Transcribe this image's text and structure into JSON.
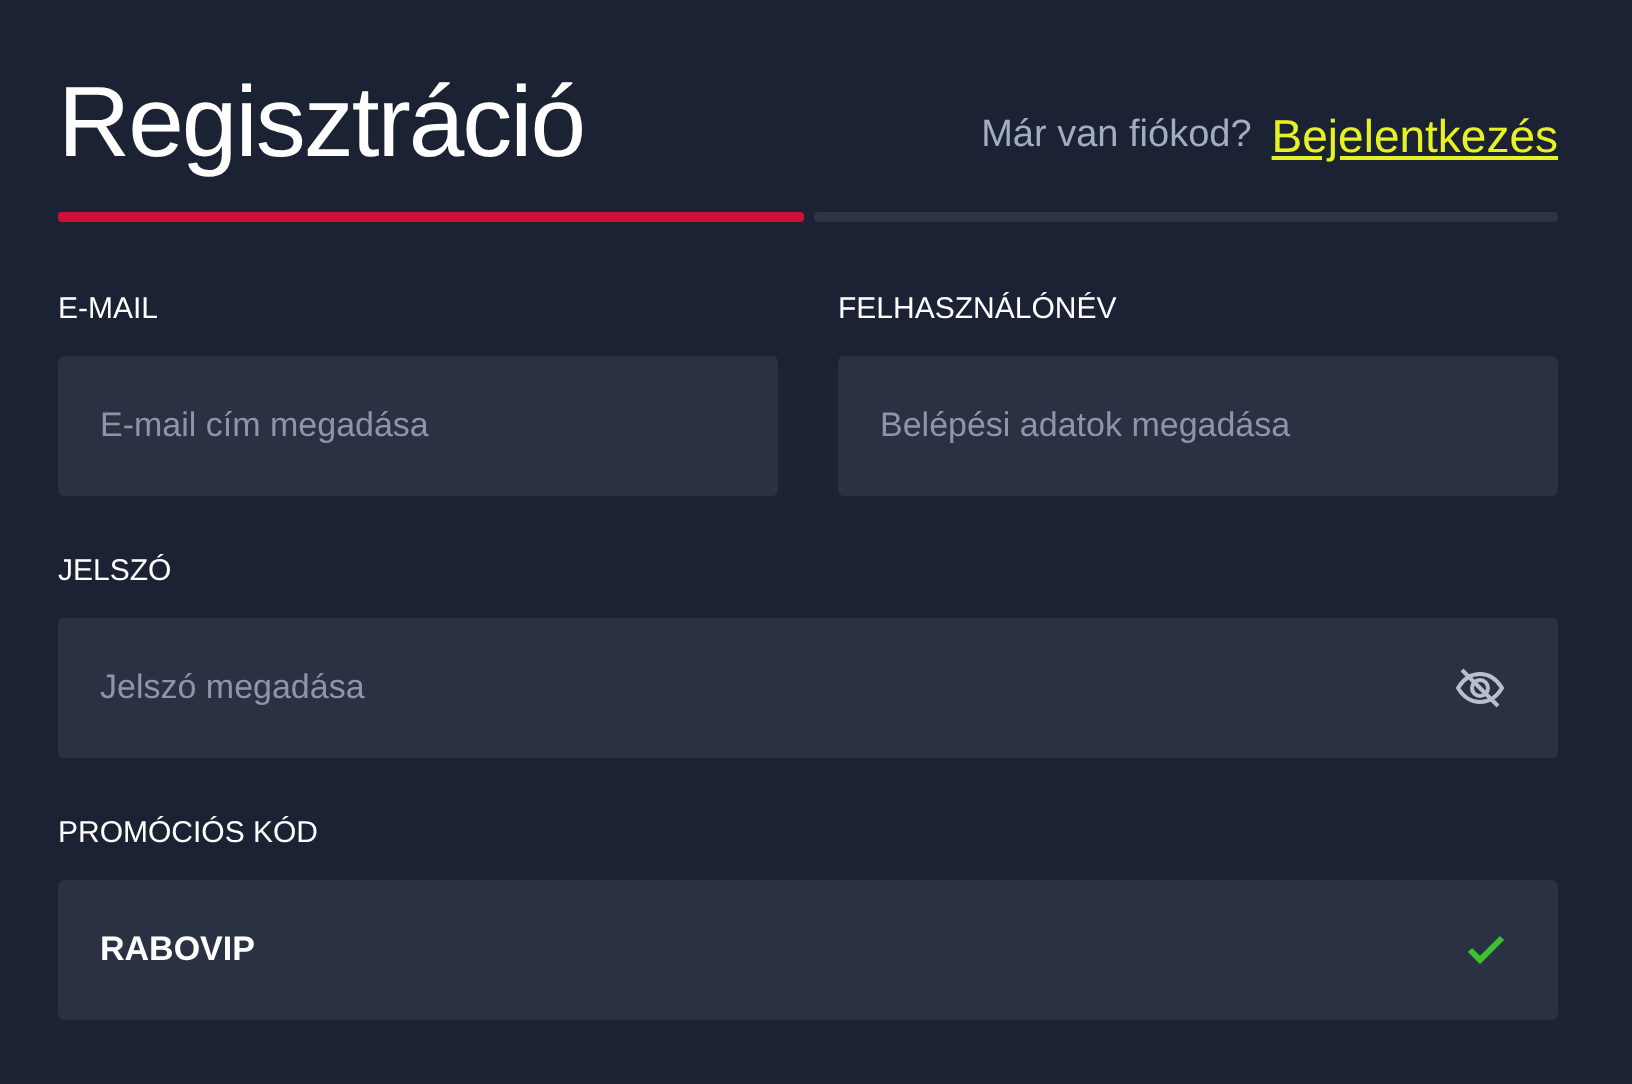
{
  "title": "Regisztráció",
  "login_prompt": {
    "text": "Már van fiókod?",
    "link": "Bejelentkezés"
  },
  "steps": [
    {
      "selected": true
    },
    {
      "selected": false
    }
  ],
  "rows": [
    {
      "fields": [
        {
          "label": "E-MAIL",
          "kind": "text",
          "placeholder": "E-mail cím megadása"
        },
        {
          "label": "FELHASZNÁLÓNÉV",
          "kind": "text",
          "placeholder": "Belépési adatok megadása"
        }
      ]
    },
    {
      "fields": [
        {
          "label": "JELSZÓ",
          "kind": "password",
          "placeholder": "Jelszó megadása"
        }
      ]
    },
    {
      "fields": [
        {
          "label": "PROMÓCIÓS KÓD",
          "kind": "text",
          "value": "RABOVIP",
          "valid": true
        }
      ]
    }
  ]
}
